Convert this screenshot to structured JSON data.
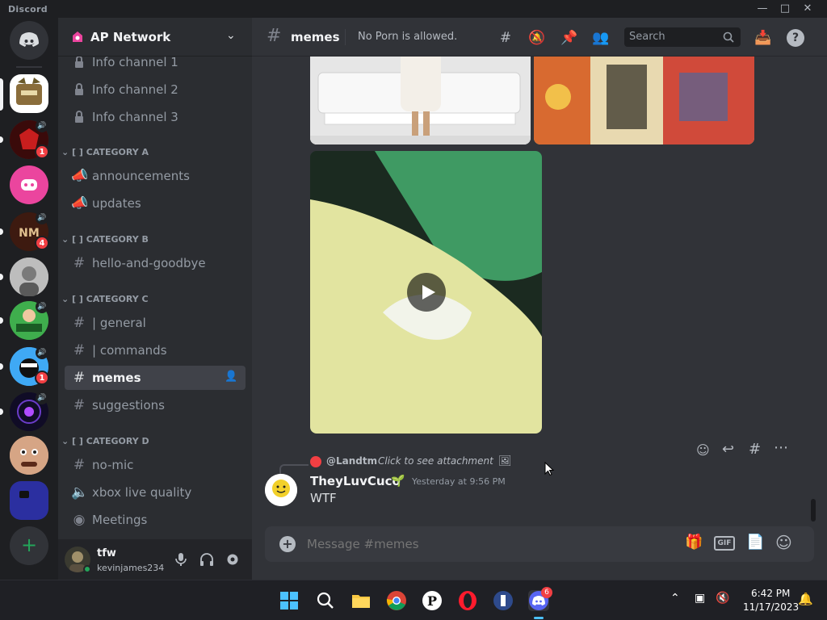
{
  "window": {
    "title": "Discord"
  },
  "servers": {
    "home_label": "Direct Messages",
    "list": [
      {
        "badge": ""
      },
      {
        "badge": "1"
      },
      {
        "badge": ""
      },
      {
        "badge": "4"
      },
      {
        "badge": ""
      },
      {
        "badge": ""
      },
      {
        "badge": "1"
      },
      {
        "badge": ""
      },
      {
        "badge": ""
      },
      {
        "badge": ""
      }
    ]
  },
  "sidebar": {
    "server_name": "AP Network",
    "locked_channels": [
      "Info channel 1",
      "Info channel 2",
      "Info channel 3"
    ],
    "categories": [
      {
        "name": "[ ] CATEGORY A",
        "channels": [
          "announcements",
          "updates"
        ]
      },
      {
        "name": "[ ] CATEGORY B",
        "channels": [
          "hello-and-goodbye"
        ]
      },
      {
        "name": "[ ] CATEGORY C",
        "channels": [
          "| general",
          "| commands",
          "memes",
          "suggestions"
        ]
      },
      {
        "name": "[ ] CATEGORY D",
        "channels": [
          "no-mic",
          "xbox live quality",
          "Meetings"
        ]
      }
    ],
    "selected_channel": "memes"
  },
  "user": {
    "display_name": "tfw",
    "username": "kevinjames234"
  },
  "header": {
    "channel": "memes",
    "topic": "No Porn is allowed.",
    "search_placeholder": "Search"
  },
  "message": {
    "reply_to": "@Landtm",
    "reply_preview": "Click to see attachment",
    "author": "TheyLuvCuco",
    "timestamp": "Yesterday at 9:56 PM",
    "content": "WTF"
  },
  "composer": {
    "placeholder": "Message #memes",
    "gif_label": "GIF"
  },
  "taskbar": {
    "time": "6:42 PM",
    "date": "11/17/2023",
    "discord_badge": "6"
  },
  "colors": {
    "accent": "#5865f2",
    "danger": "#f23f43",
    "background": "#313338",
    "sidebar": "#2b2d31",
    "rail": "#1e1f22",
    "online": "#23a55a"
  }
}
